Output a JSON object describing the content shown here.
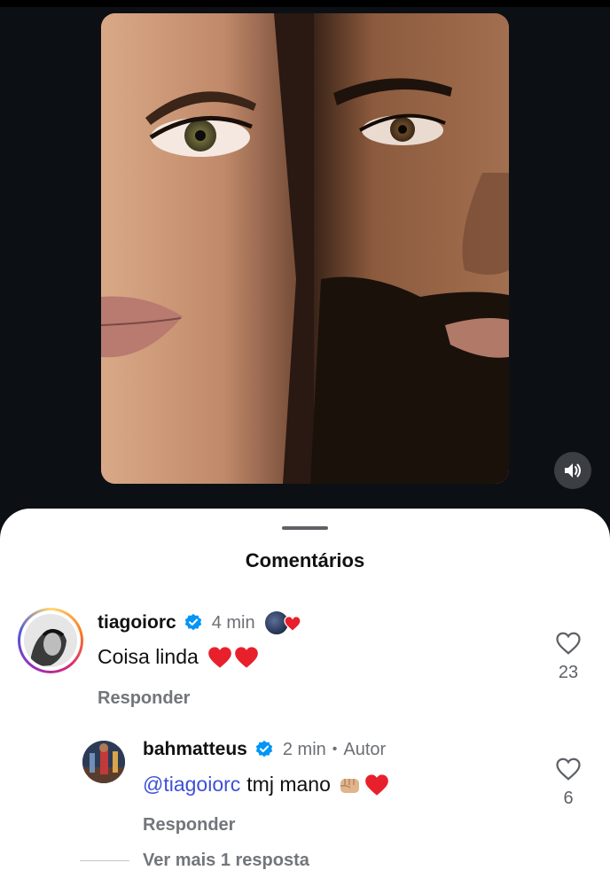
{
  "media": {
    "sound_icon": "speaker-icon"
  },
  "comments_sheet": {
    "title": "Comentários"
  },
  "comments": [
    {
      "username": "tiagoiorc",
      "verified": true,
      "time": "4 min",
      "liked_by_author": true,
      "text": "Coisa linda",
      "emoji": "❤️❤️",
      "reply_label": "Responder",
      "like_count": "23"
    },
    {
      "username": "bahmatteus",
      "verified": true,
      "time": "2 min",
      "separator": "•",
      "author_label": "Autor",
      "mention": "@tiagoiorc",
      "text": "tmj mano",
      "emoji": "👊🏼❤️",
      "reply_label": "Responder",
      "like_count": "6"
    }
  ],
  "view_more_label": "Ver mais 1 resposta",
  "colors": {
    "background": "#0c1014",
    "sheet": "#ffffff",
    "mention": "#3d4fd6",
    "verified": "#0095f6",
    "heart": "#e8202c"
  }
}
